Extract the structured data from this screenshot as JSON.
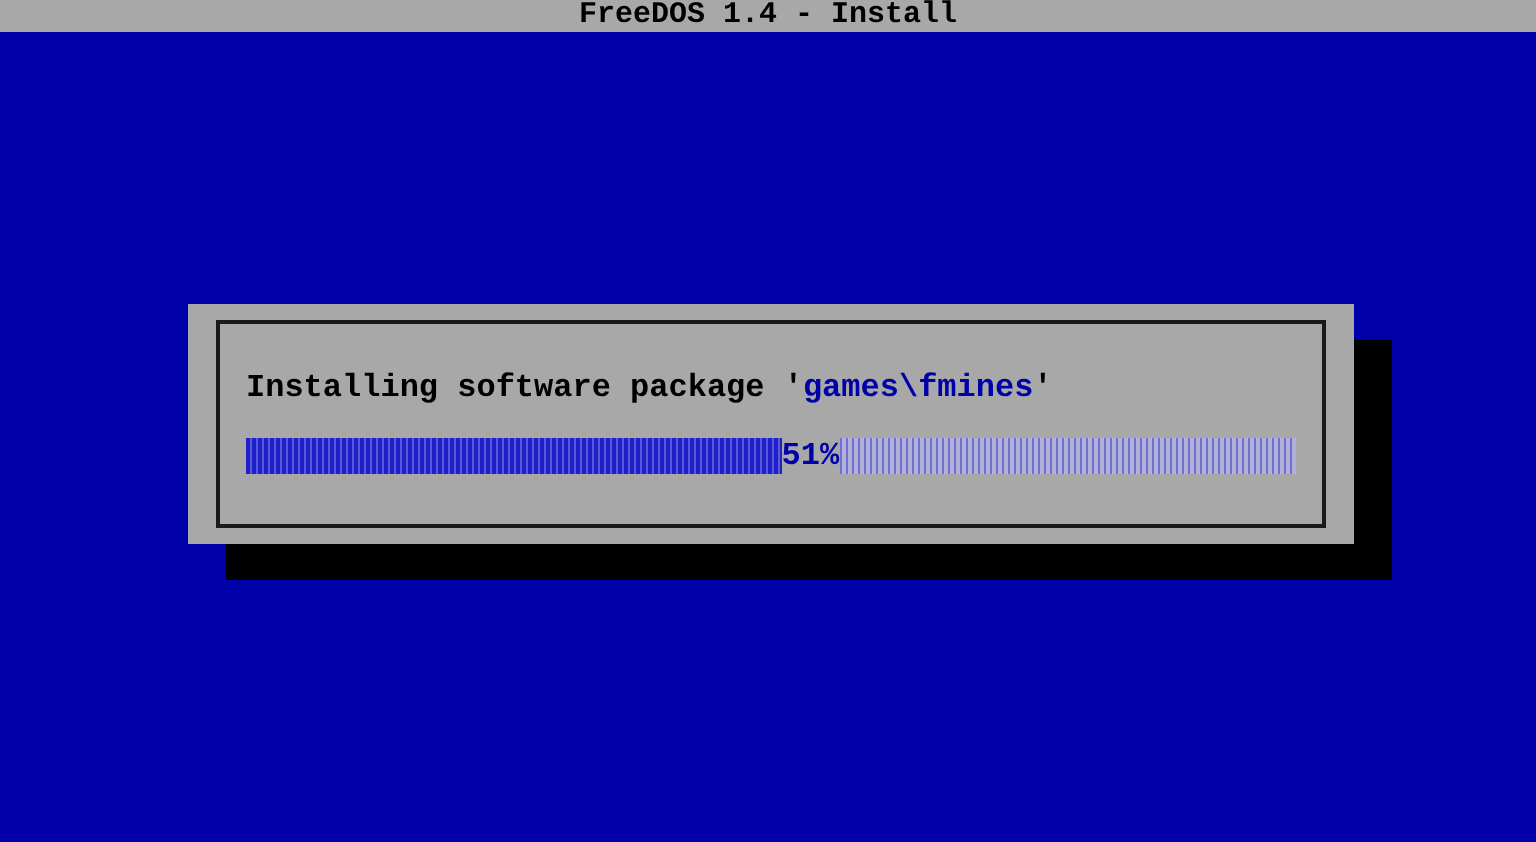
{
  "title_bar": {
    "title": "FreeDOS 1.4 - Install"
  },
  "dialog": {
    "message": [
      {
        "text": "Installing software package '",
        "kind": "plain"
      },
      {
        "text": "games\\fmines",
        "kind": "highlight"
      },
      {
        "text": "'",
        "kind": "plain"
      }
    ],
    "progress": {
      "level": 0.51,
      "reading": "51%"
    }
  }
}
